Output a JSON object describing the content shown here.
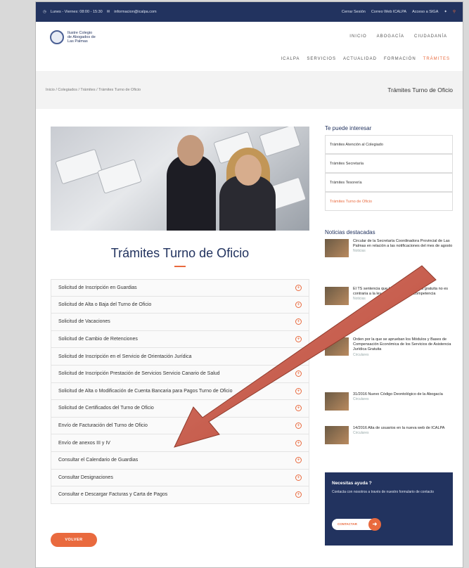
{
  "topbar": {
    "contact": "Lunes - Viernes: 08:00 - 15:30",
    "email": "informacion@icalpa.com",
    "login": "Cerrar Sesión",
    "webmail": "Correo Web ICALPA",
    "sigia": "Acceso a SIGA",
    "search_icon": "search-icon"
  },
  "logo": {
    "text": "Ilustre Colegio de Abogados de Las Palmas"
  },
  "nav_top": [
    "INICIO",
    "ABOGACÍA",
    "CIUDADANÍA"
  ],
  "nav_main": [
    "ICALPA",
    "SERVICIOS",
    "ACTUALIDAD",
    "FORMACIÓN",
    "TRÁMITES"
  ],
  "breadcrumb": "Inicio / Colegiados / Trámites / Trámites Turno de Oficio",
  "page_title": "Trámites Turno de Oficio",
  "main_title": "Trámites Turno de Oficio",
  "accordion": [
    "Solicitud de Inscripción en Guardias",
    "Solicitud de Alta o Baja del Turno de Oficio",
    "Solicitud de Vacaciones",
    "Solicitud de Cambio de Retenciones",
    "Solicitud de Inscripción en el Servicio de Orientación Jurídica",
    "Solicitud de Inscripción Prestación de Servicios Servicio Canario de Salud",
    "Solicitud de Alta o Modificación de Cuenta Bancaria para Pagos Turno de Oficio",
    "Solicitud de Certificados del Turno de Oficio",
    "Envío de Facturación del Turno de Oficio",
    "Envío de anexos III y IV",
    "Consultar el Calendario de Guardias",
    "Consultar Designaciones",
    "Consultar e Descargar Facturas y Carta de Pagos"
  ],
  "back_button": "VOLVER",
  "sidebar": {
    "interest_heading": "Te puede interesar",
    "links": [
      "Trámites Atención al Colegiado",
      "Trámites Secretaría",
      "Trámites Tesorería",
      "Trámites Turno de Oficio"
    ],
    "news_heading": "Noticias destacadas",
    "news": [
      {
        "text": "Circular de la Secretaría Coordinadora Provincial de Las Palmas en relación a las notificaciones del mes de agosto",
        "tag": "Noticias"
      },
      {
        "text": "El TS sentencia que la asistencia jurídica gratuita no es contraria a la ley de Defensa de la Competencia",
        "tag": "Noticias"
      },
      {
        "text": "Orden por la que se aprueban los Módulos y Bases de Compensación Económica de los Servicios de Asistencia Jurídica Gratuita",
        "tag": "Circulares"
      },
      {
        "text": "31/2016 Nuevo Código Deontológico de la Abogacía",
        "tag": "Circulares"
      },
      {
        "text": "14/2016 Alta de usuarios en la nueva web de ICALPA",
        "tag": "Circulares"
      }
    ],
    "help_title": "Necesitas ayuda ?",
    "help_text": "Contacta con nosotros a través de nuestro formulario de contacto",
    "help_button": "CONTACTAR"
  }
}
